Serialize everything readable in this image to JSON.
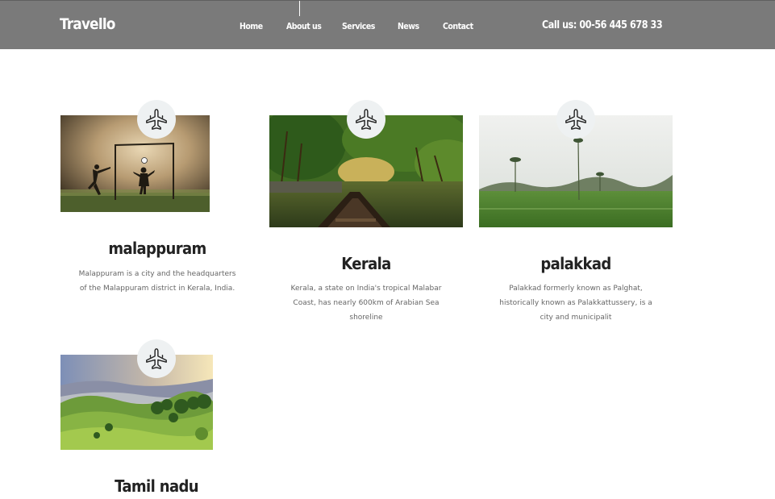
{
  "header": {
    "brand": "Travello",
    "nav": [
      {
        "label": "Home"
      },
      {
        "label": "About us"
      },
      {
        "label": "Services"
      },
      {
        "label": "News"
      },
      {
        "label": "Contact"
      }
    ],
    "call": "Call us: 00-56 445 678 33"
  },
  "destinations": [
    {
      "title": "malappuram",
      "description": "Malappuram is a city and the headquarters of the Malappuram district in Kerala, India.",
      "icon": "airplane-icon"
    },
    {
      "title": "Kerala",
      "description": "Kerala, a state on India's tropical Malabar Coast, has nearly 600km of Arabian Sea shoreline",
      "icon": "airplane-icon"
    },
    {
      "title": "palakkad",
      "description": "Palakkad formerly known as Palghat, historically known as Palakkattussery, is a city and municipalit",
      "icon": "airplane-icon"
    },
    {
      "title": "Tamil nadu",
      "description": "",
      "icon": "airplane-icon"
    }
  ],
  "colors": {
    "header_bg": "#7a7a7a",
    "badge_bg": "#eef1f2",
    "title": "#222222",
    "text": "#666666"
  }
}
